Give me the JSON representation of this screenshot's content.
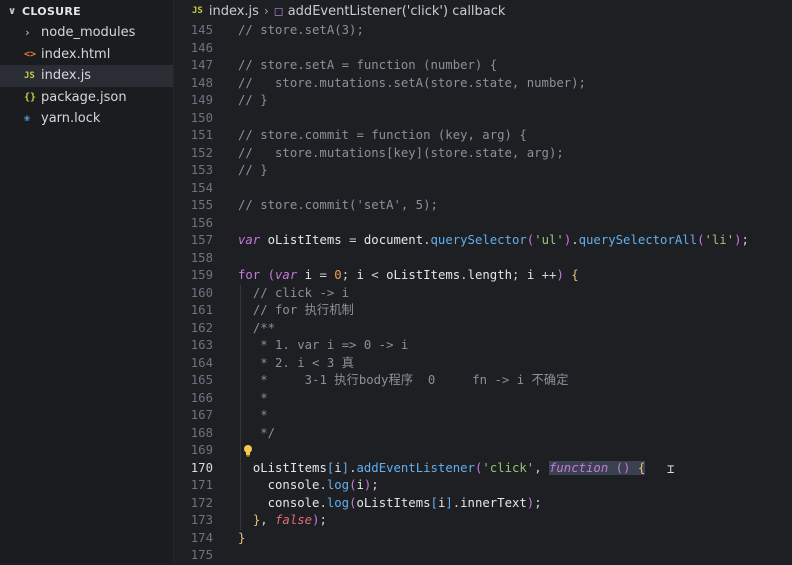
{
  "explorer": {
    "folder_name": "CLOSURE",
    "items": [
      {
        "label": "node_modules",
        "icon": "chevron-right-icon"
      },
      {
        "label": "index.html",
        "icon": "html-file-icon"
      },
      {
        "label": "index.js",
        "icon": "js-file-icon",
        "active": true
      },
      {
        "label": "package.json",
        "icon": "json-file-icon"
      },
      {
        "label": "yarn.lock",
        "icon": "yarn-file-icon"
      }
    ]
  },
  "breadcrumb": {
    "file_badge": "JS",
    "file": "index.js",
    "symbol": "addEventListener('click') callback"
  },
  "editor": {
    "current_line": 170,
    "lines": [
      {
        "n": "145",
        "text": "// store.setA(3);"
      },
      {
        "n": "146",
        "text": ""
      },
      {
        "n": "147",
        "text": "// store.setA = function (number) {"
      },
      {
        "n": "148",
        "text": "//   store.mutations.setA(store.state, number);"
      },
      {
        "n": "149",
        "text": "// }"
      },
      {
        "n": "150",
        "text": ""
      },
      {
        "n": "151",
        "text": "// store.commit = function (key, arg) {"
      },
      {
        "n": "152",
        "text": "//   store.mutations[key](store.state, arg);"
      },
      {
        "n": "153",
        "text": "// }"
      },
      {
        "n": "154",
        "text": ""
      },
      {
        "n": "155",
        "text": "// store.commit('setA', 5);"
      },
      {
        "n": "156",
        "text": ""
      },
      {
        "n": "157",
        "text": "var oListItems = document.querySelector('ul').querySelectorAll('li');"
      },
      {
        "n": "158",
        "text": ""
      },
      {
        "n": "159",
        "text": "for (var i = 0; i < oListItems.length; i ++) {"
      },
      {
        "n": "160",
        "text": "  // click -> i"
      },
      {
        "n": "161",
        "text": "  // for 执行机制"
      },
      {
        "n": "162",
        "text": "  /**"
      },
      {
        "n": "163",
        "text": "   * 1. var i => 0 -> i"
      },
      {
        "n": "164",
        "text": "   * 2. i < 3 真"
      },
      {
        "n": "165",
        "text": "   *     3-1 执行body程序  0     fn -> i 不确定"
      },
      {
        "n": "166",
        "text": "   *"
      },
      {
        "n": "167",
        "text": "   *"
      },
      {
        "n": "168",
        "text": "   */"
      },
      {
        "n": "169",
        "text": ""
      },
      {
        "n": "170",
        "text": "  oListItems[i].addEventListener('click', function () {"
      },
      {
        "n": "171",
        "text": "    console.log(i);"
      },
      {
        "n": "172",
        "text": "    console.log(oListItems[i].innerText);"
      },
      {
        "n": "173",
        "text": "  }, false);"
      },
      {
        "n": "174",
        "text": "}"
      },
      {
        "n": "175",
        "text": ""
      }
    ]
  }
}
